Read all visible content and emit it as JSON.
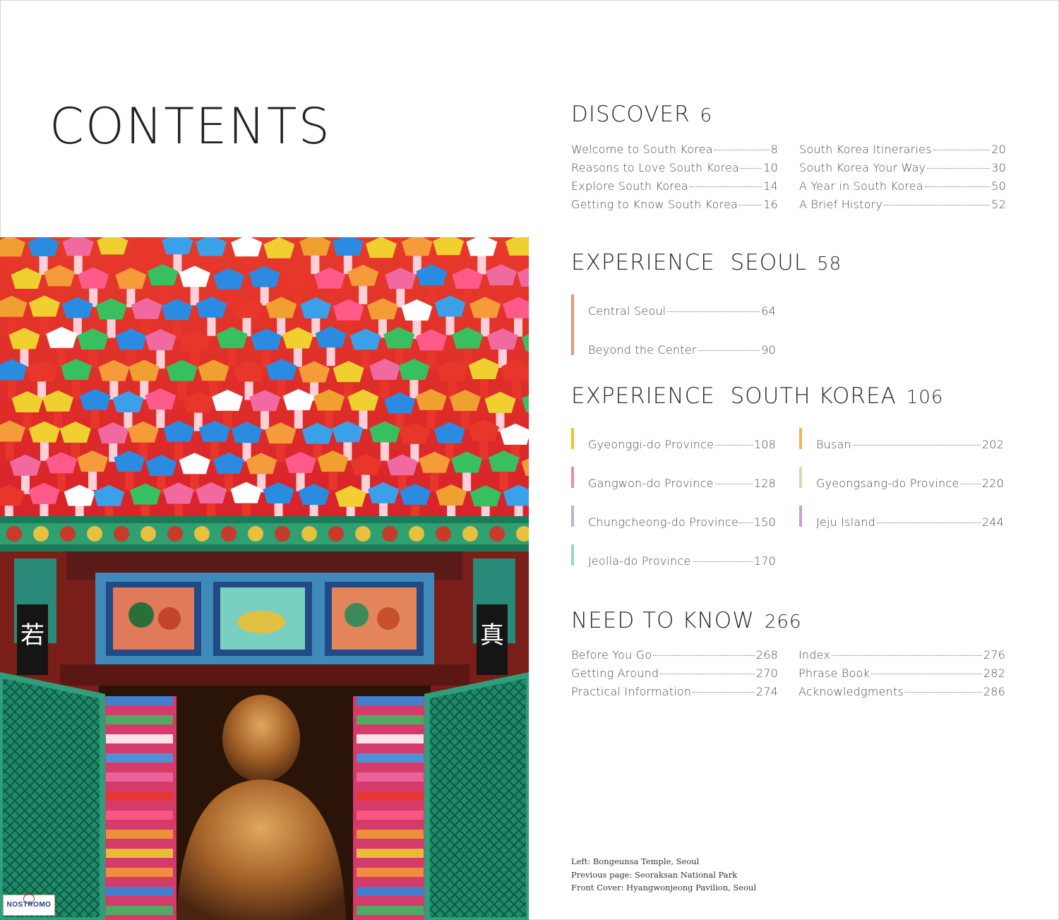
{
  "page_title": "CONTENTS",
  "discover": {
    "heading": "DISCOVER",
    "page": "6",
    "left": [
      {
        "title": "Welcome to South Korea",
        "page": "8"
      },
      {
        "title": "Reasons to Love South Korea",
        "page": "10"
      },
      {
        "title": "Explore South Korea",
        "page": "14"
      },
      {
        "title": "Getting to Know South Korea",
        "page": "16"
      }
    ],
    "right": [
      {
        "title": "South Korea Itineraries",
        "page": "20"
      },
      {
        "title": "South Korea Your Way",
        "page": "30"
      },
      {
        "title": "A Year in South Korea",
        "page": "50"
      },
      {
        "title": "A Brief History",
        "page": "52"
      }
    ]
  },
  "seoul": {
    "heading": "EXPERIENCE  SEOUL",
    "page": "58",
    "bar_color": "#e8957a",
    "items": [
      {
        "title": "Central Seoul",
        "page": "64"
      },
      {
        "title": "Beyond the Center",
        "page": "90"
      }
    ]
  },
  "korea": {
    "heading": "EXPERIENCE  SOUTH KOREA",
    "page": "106",
    "left": [
      {
        "title": "Gyeonggi-do Province",
        "page": "108",
        "color": "#f2c230"
      },
      {
        "title": "Gangwon-do Province",
        "page": "128",
        "color": "#ec8ba0"
      },
      {
        "title": "Chungcheong-do Province",
        "page": "150",
        "color": "#b4b4d8"
      },
      {
        "title": "Jeolla-do Province",
        "page": "170",
        "color": "#9fd3c7"
      }
    ],
    "right": [
      {
        "title": "Busan",
        "page": "202",
        "color": "#f0b25a"
      },
      {
        "title": "Gyeongsang-do Province",
        "page": "220",
        "color": "#d8d9b4"
      },
      {
        "title": "Jeju Island",
        "page": "244",
        "color": "#c9a0d0"
      }
    ]
  },
  "need": {
    "heading": "NEED TO KNOW",
    "page": "266",
    "left": [
      {
        "title": "Before You Go",
        "page": "268"
      },
      {
        "title": "Getting Around",
        "page": "270"
      },
      {
        "title": "Practical Information",
        "page": "274"
      }
    ],
    "right": [
      {
        "title": "Index",
        "page": "276"
      },
      {
        "title": "Phrase Book",
        "page": "282"
      },
      {
        "title": "Acknowledgments",
        "page": "286"
      }
    ]
  },
  "captions": [
    "Left: Bongeunsa Temple, Seoul",
    "Previous page: Seoraksan National Park",
    "Front Cover: Hyangwonjeong Pavilion, Seoul"
  ],
  "watermark": "NOSTROMO"
}
